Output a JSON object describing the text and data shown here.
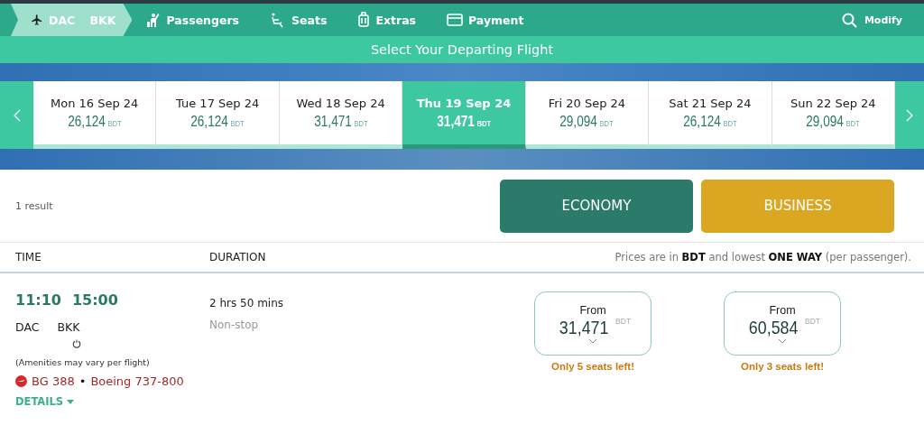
{
  "steps": [
    {
      "kind": "route",
      "label": "DAC BKK",
      "selected": true
    },
    {
      "kind": "passengers",
      "label": "Passengers",
      "selected": false
    },
    {
      "kind": "seats",
      "label": "Seats",
      "selected": false
    },
    {
      "kind": "extras",
      "label": "Extras",
      "selected": false
    },
    {
      "kind": "payment",
      "label": "Payment",
      "selected": false
    }
  ],
  "modify": "Modify",
  "subtitle": "Select Your Departing Flight",
  "dates": [
    {
      "day": "Mon 16 Sep 24",
      "price": "26,124",
      "currency": "BDT",
      "selected": false
    },
    {
      "day": "Tue 17 Sep 24",
      "price": "26,124",
      "currency": "BDT",
      "selected": false
    },
    {
      "day": "Wed 18 Sep 24",
      "price": "31,471",
      "currency": "BDT",
      "selected": false
    },
    {
      "day": "Thu 19 Sep 24",
      "price": "31,471",
      "currency": "BDT",
      "selected": true
    },
    {
      "day": "Fri 20 Sep 24",
      "price": "29,094",
      "currency": "BDT",
      "selected": false
    },
    {
      "day": "Sat 21 Sep 24",
      "price": "26,124",
      "currency": "BDT",
      "selected": false
    },
    {
      "day": "Sun 22 Sep 24",
      "price": "29,094",
      "currency": "BDT",
      "selected": false
    }
  ],
  "result_count": "1 result",
  "cabins": [
    {
      "kind": "economy",
      "label": "ECONOMY"
    },
    {
      "kind": "business",
      "label": "BUSINESS"
    }
  ],
  "columns": [
    "TIME",
    "DURATION"
  ],
  "price_note": "Prices are in **BDT** and lowest **ONE WAY** (per passenger).",
  "flight": {
    "depart_time": "11:10",
    "arrive_time": "15:00",
    "origin": "DAC",
    "destination": "BKK",
    "amenities": "(Amenities may vary per flight)",
    "flight_number": "BG 388",
    "separator": "•",
    "aircraft": "Boeing 737-800",
    "details": "DETAILS",
    "duration": "2 hrs 50 mins",
    "stops": "Non-stop",
    "fares": [
      {
        "from": "From",
        "price": "31,471",
        "currency": "BDT",
        "seats_left": "Only 5 seats left!"
      },
      {
        "from": "From",
        "price": "60,584",
        "currency": "BDT",
        "seats_left": "Only 3 seats left!"
      }
    ]
  }
}
